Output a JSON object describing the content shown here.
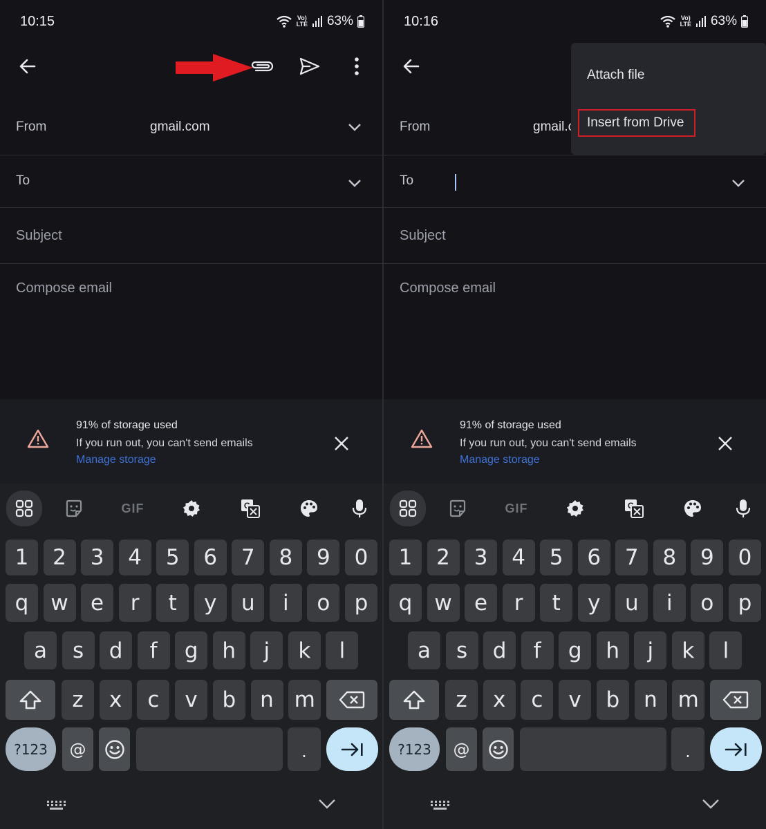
{
  "screens": [
    {
      "status": {
        "time": "10:15",
        "battery": "63%",
        "lte_top": "Vo)",
        "lte_bottom": "LTE"
      },
      "from": {
        "label": "From",
        "value": "gmail.com"
      },
      "to": {
        "label": "To"
      },
      "subject": {
        "placeholder": "Subject"
      },
      "compose": {
        "placeholder": "Compose email"
      },
      "banner": {
        "title": "91% of storage used",
        "subtitle": "If you run out, you can't send emails",
        "link": "Manage storage"
      }
    },
    {
      "status": {
        "time": "10:16",
        "battery": "63%",
        "lte_top": "Vo)",
        "lte_bottom": "LTE"
      },
      "from": {
        "label": "From",
        "value": "gmail.c"
      },
      "to": {
        "label": "To"
      },
      "subject": {
        "placeholder": "Subject"
      },
      "compose": {
        "placeholder": "Compose email"
      },
      "menu": {
        "items": [
          "Attach file",
          "Insert from Drive"
        ]
      },
      "banner": {
        "title": "91% of storage used",
        "subtitle": "If you run out, you can't send emails",
        "link": "Manage storage"
      }
    }
  ],
  "keyboard": {
    "toolbar": {
      "gif": "GIF"
    },
    "row_numbers": [
      "1",
      "2",
      "3",
      "4",
      "5",
      "6",
      "7",
      "8",
      "9",
      "0"
    ],
    "row_q": [
      "q",
      "w",
      "e",
      "r",
      "t",
      "y",
      "u",
      "i",
      "o",
      "p"
    ],
    "row_a": [
      "a",
      "s",
      "d",
      "f",
      "g",
      "h",
      "j",
      "k",
      "l"
    ],
    "row_z": [
      "z",
      "x",
      "c",
      "v",
      "b",
      "n",
      "m"
    ],
    "symbols": "?123",
    "at": "@",
    "period": "."
  },
  "colors": {
    "accent_link": "#3f72d6",
    "highlight_box": "#d01f25",
    "enter_key": "#c5e6f9",
    "warning": "#f0a79b"
  }
}
